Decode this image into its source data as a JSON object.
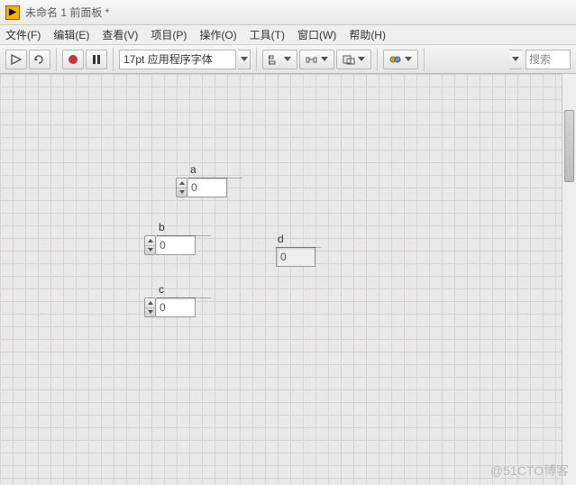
{
  "title": "未命名 1 前面板 *",
  "menu": {
    "file": "文件(F)",
    "edit": "编辑(E)",
    "view": "查看(V)",
    "project": "项目(P)",
    "operate": "操作(O)",
    "tools": "工具(T)",
    "window": "窗口(W)",
    "help": "帮助(H)"
  },
  "toolbar": {
    "font_combo": "17pt 应用程序字体"
  },
  "search": {
    "placeholder": "搜索"
  },
  "controls": {
    "a": {
      "label": "a",
      "value": "0"
    },
    "b": {
      "label": "b",
      "value": "0"
    },
    "c": {
      "label": "c",
      "value": "0"
    },
    "d": {
      "label": "d",
      "value": "0"
    }
  },
  "watermark": "@51CTO博客",
  "colors": {
    "accent": "#ffb300",
    "grid": "#d6d2d2",
    "canvas": "#e9e9e9"
  }
}
